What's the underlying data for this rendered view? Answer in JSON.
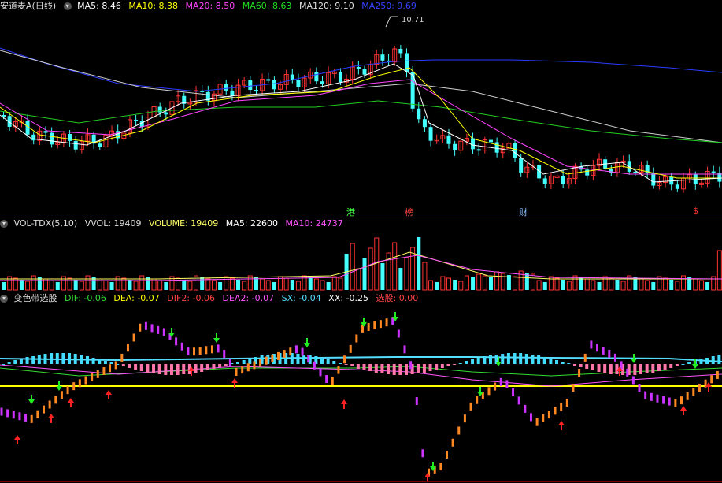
{
  "price_panel": {
    "title": "安道麦A(日线)",
    "ma5": {
      "label": "MA5: 8.46",
      "color": "#ffffff"
    },
    "ma10": {
      "label": "MA10: 8.38",
      "color": "#ffff00"
    },
    "ma20": {
      "label": "MA20: 8.50",
      "color": "#ff44ff"
    },
    "ma60": {
      "label": "MA60: 8.63",
      "color": "#22dd22"
    },
    "ma120": {
      "label": "MA120: 9.10",
      "color": "#e0e0e0"
    },
    "ma250": {
      "label": "MA250: 9.69",
      "color": "#3344ff"
    },
    "peak_label": "10.71",
    "markers": [
      {
        "text": "港",
        "color": "#44ff44"
      },
      {
        "text": "榜",
        "color": "#ff4444"
      },
      {
        "text": "财",
        "color": "#88bbff"
      },
      {
        "text": "$",
        "color": "#ff3333"
      }
    ]
  },
  "volume_panel": {
    "title": "VOL-TDX(5,10)",
    "vvol": "VVOL: 19409",
    "volume": {
      "label": "VOLUME: 19409",
      "color": "#ffff66"
    },
    "ma5": {
      "label": "MA5: 22600",
      "color": "#ffffff"
    },
    "ma10": {
      "label": "MA10: 24737",
      "color": "#ff55ff"
    }
  },
  "indicator_panel": {
    "title": "变色带选股",
    "dif": {
      "label": "DIF: -0.06",
      "color": "#33dd33"
    },
    "dea": {
      "label": "DEA: -0.07",
      "color": "#ffff00"
    },
    "dif2": {
      "label": "DIF2: -0.06",
      "color": "#ff4444"
    },
    "dea2": {
      "label": "DEA2: -0.07",
      "color": "#ff55ff"
    },
    "sx": {
      "label": "SX: -0.04",
      "color": "#55ddff"
    },
    "xx": {
      "label": "XX: -0.25",
      "color": "#ffffff"
    },
    "pick": {
      "label": "选股: 0.00",
      "color": "#ff4444"
    }
  }
}
